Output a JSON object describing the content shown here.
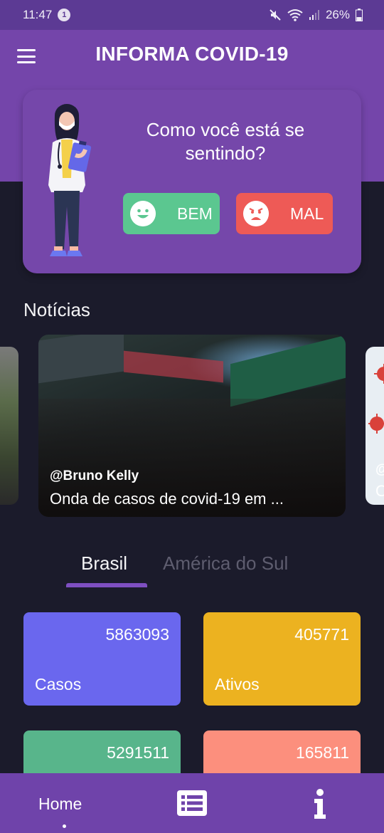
{
  "status_bar": {
    "time": "11:47",
    "notification_count": "1",
    "battery": "26%",
    "icons": [
      "mute-icon",
      "wifi-icon",
      "signal-icon",
      "battery-icon"
    ]
  },
  "header": {
    "title": "INFORMA COVID-19",
    "menu_icon": "hamburger-menu-icon"
  },
  "feeling": {
    "question": "Como você está se sentindo?",
    "good_label": "BEM",
    "bad_label": "MAL",
    "good_color": "#5bc790",
    "bad_color": "#ee5a56"
  },
  "news": {
    "section_title": "Notícias",
    "items": [
      {
        "author": "@Bruno Kelly",
        "headline": "Onda de casos de covid-19 em ..."
      }
    ],
    "peek_right_author_fragment": "@",
    "peek_right_headline_fragment": "O"
  },
  "tabs": {
    "items": [
      "Brasil",
      "América do Sul"
    ],
    "selected": "Brasil"
  },
  "stats": {
    "casos": {
      "label": "Casos",
      "value": "5863093",
      "color": "#6a67ee"
    },
    "ativos": {
      "label": "Ativos",
      "value": "405771",
      "color": "#ecb220"
    },
    "recuperados": {
      "value": "5291511",
      "color": "#58b58b"
    },
    "obitos": {
      "value": "165811",
      "color": "#fc8f7d"
    }
  },
  "bottom_nav": {
    "home_label": "Home",
    "list_icon": "list-icon",
    "info_icon": "info-icon",
    "accent": "#6f43aa"
  }
}
